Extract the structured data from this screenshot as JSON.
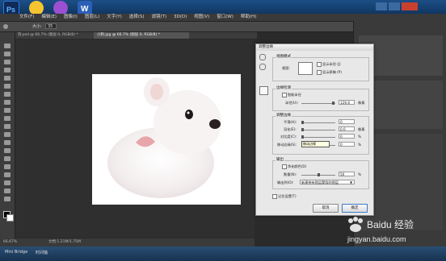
{
  "menubar": {
    "items": [
      "文件(F)",
      "编辑(E)",
      "图像(I)",
      "图层(L)",
      "文字(Y)",
      "选择(S)",
      "滤镜(T)",
      "3D(D)",
      "视图(V)",
      "窗口(W)",
      "帮助(H)"
    ]
  },
  "options": {
    "size_label": "大小:",
    "size_value": "35"
  },
  "tabs": [
    {
      "label": "狗.psd @ 66.7% (图层 0, RGB/8) *"
    },
    {
      "label": "小狗.jpg @ 66.7% (图层 0, RGB/8) *"
    }
  ],
  "status": {
    "zoom": "66.67%",
    "doc": "文档:1.21M/1.75M"
  },
  "taskbar_bottom": {
    "items": [
      "Mini Bridge",
      "时间轴"
    ]
  },
  "dialog": {
    "title": "调整边缘",
    "view_mode": {
      "group_label": "视图模式",
      "view_label": "视图:",
      "show_radius": "显示半径 (J)",
      "show_original": "显示原稿 (P)"
    },
    "edge_detection": {
      "group_label": "边缘检测",
      "smart_radius": "智能半径",
      "radius_label": "半径(U):",
      "radius_value": "126.6",
      "radius_unit": "像素"
    },
    "adjust_edge": {
      "group_label": "调整边缘",
      "smooth_label": "平滑(H):",
      "smooth_value": "0",
      "feather_label": "羽化(E):",
      "feather_value": "0.0",
      "feather_unit": "像素",
      "contrast_label": "对比度(C):",
      "contrast_value": "0",
      "contrast_unit": "%",
      "shift_label": "移动边缘(S):",
      "shift_value": "0",
      "shift_unit": "%"
    },
    "output": {
      "group_label": "输出",
      "decontaminate": "净化颜色(D)",
      "amount_label": "数量(N):",
      "amount_value": "50",
      "amount_unit": "%",
      "output_to_label": "输出到(O):",
      "output_to_value": "新建带有图层蒙版的图层"
    },
    "remember": "记住设置(T)",
    "cancel": "取消",
    "ok": "确定"
  },
  "tooltip": "移动边缘",
  "watermark": {
    "brand": "Baidu 经验",
    "url": "jingyan.baidu.com"
  },
  "colors": {
    "accent": "#1c4f86",
    "dialog_bg": "#e8e8e8"
  }
}
